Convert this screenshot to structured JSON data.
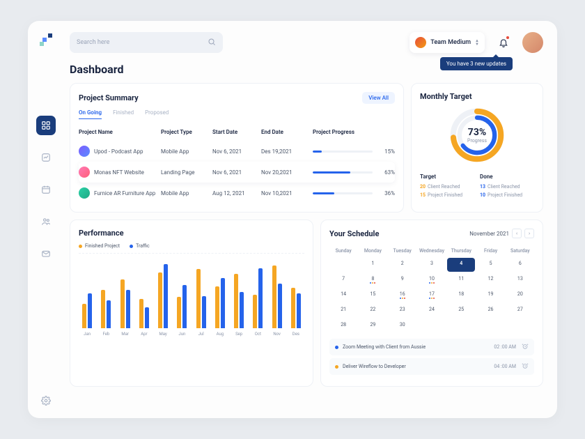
{
  "search": {
    "placeholder": "Search here"
  },
  "team": {
    "label": "Team Medium"
  },
  "tooltip": "You have 3 new updates",
  "page_title": "Dashboard",
  "summary": {
    "title": "Project Summary",
    "view_all": "View All",
    "tabs": [
      "On Going",
      "Finished",
      "Proposed"
    ],
    "active_tab": 0,
    "columns": [
      "Project Name",
      "Project Type",
      "Start Date",
      "End Date",
      "Project Progress"
    ],
    "rows": [
      {
        "name": "Upod - Podcast App",
        "type": "Mobile App",
        "start": "Nov 6, 2021",
        "end": "Des 19,2021",
        "progress": 15,
        "icon_bg": "linear-gradient(135deg,#7c5cff,#5b8cff)"
      },
      {
        "name": "Monas NFT Website",
        "type": "Landing Page",
        "start": "Nov 6, 2021",
        "end": "Nov 20,2021",
        "progress": 63,
        "icon_bg": "linear-gradient(135deg,#ff7ab6,#ff5e78)"
      },
      {
        "name": "Furnice AR  Furniture App",
        "type": "Mobile App",
        "start": "Aug 12, 2021",
        "end": "Nov 10,2021",
        "progress": 36,
        "icon_bg": "linear-gradient(135deg,#2ad1a6,#1fa985)"
      }
    ]
  },
  "target": {
    "title": "Monthly Target",
    "percent": 73,
    "label": "Progress",
    "left_head": "Target",
    "right_head": "Done",
    "left": [
      {
        "num": "20",
        "text": "Client Reached",
        "color": "#f5a623"
      },
      {
        "num": "15",
        "text": "Project Finished",
        "color": "#f5a623"
      }
    ],
    "right": [
      {
        "num": "13",
        "text": "Client Reached",
        "color": "#2563eb"
      },
      {
        "num": "10",
        "text": "Project Finished",
        "color": "#2563eb"
      }
    ]
  },
  "performance": {
    "title": "Performance",
    "legend": [
      "Finished Project",
      "Traffic"
    ]
  },
  "chart_data": {
    "type": "bar",
    "categories": [
      "Jan",
      "Feb",
      "Mar",
      "Apr",
      "May",
      "Jun",
      "Jul",
      "Aug",
      "Sep",
      "Oct",
      "Nov",
      "Des"
    ],
    "series": [
      {
        "name": "Finished Project",
        "color": "#f5a623",
        "values": [
          35,
          55,
          70,
          42,
          80,
          45,
          85,
          60,
          78,
          48,
          90,
          58
        ]
      },
      {
        "name": "Traffic",
        "color": "#2563eb",
        "values": [
          50,
          40,
          55,
          30,
          92,
          62,
          46,
          72,
          52,
          86,
          64,
          50
        ]
      }
    ],
    "ylim": [
      0,
      100
    ]
  },
  "schedule": {
    "title": "Your Schedule",
    "month": "November 2021",
    "dow": [
      "Sunday",
      "Monday",
      "Tuesday",
      "Wednesday",
      "Thursday",
      "Friday",
      "Saturday"
    ],
    "weeks": [
      [
        null,
        1,
        2,
        3,
        4,
        5,
        6
      ],
      [
        7,
        8,
        9,
        10,
        11,
        12,
        13
      ],
      [
        14,
        15,
        16,
        17,
        18,
        19,
        20
      ],
      [
        21,
        22,
        23,
        24,
        25,
        26,
        27
      ],
      [
        28,
        29,
        30,
        null,
        null,
        null,
        null
      ]
    ],
    "active_day": 4,
    "dotted_days": [
      8,
      10,
      16,
      17
    ],
    "events": [
      {
        "title": "Zoom Meeting with Client from Aussie",
        "time": "02 :00 AM",
        "color": "#2563eb"
      },
      {
        "title": "Deliver Wireflow to Developer",
        "time": "04 :00 AM",
        "color": "#f5a623"
      }
    ]
  }
}
